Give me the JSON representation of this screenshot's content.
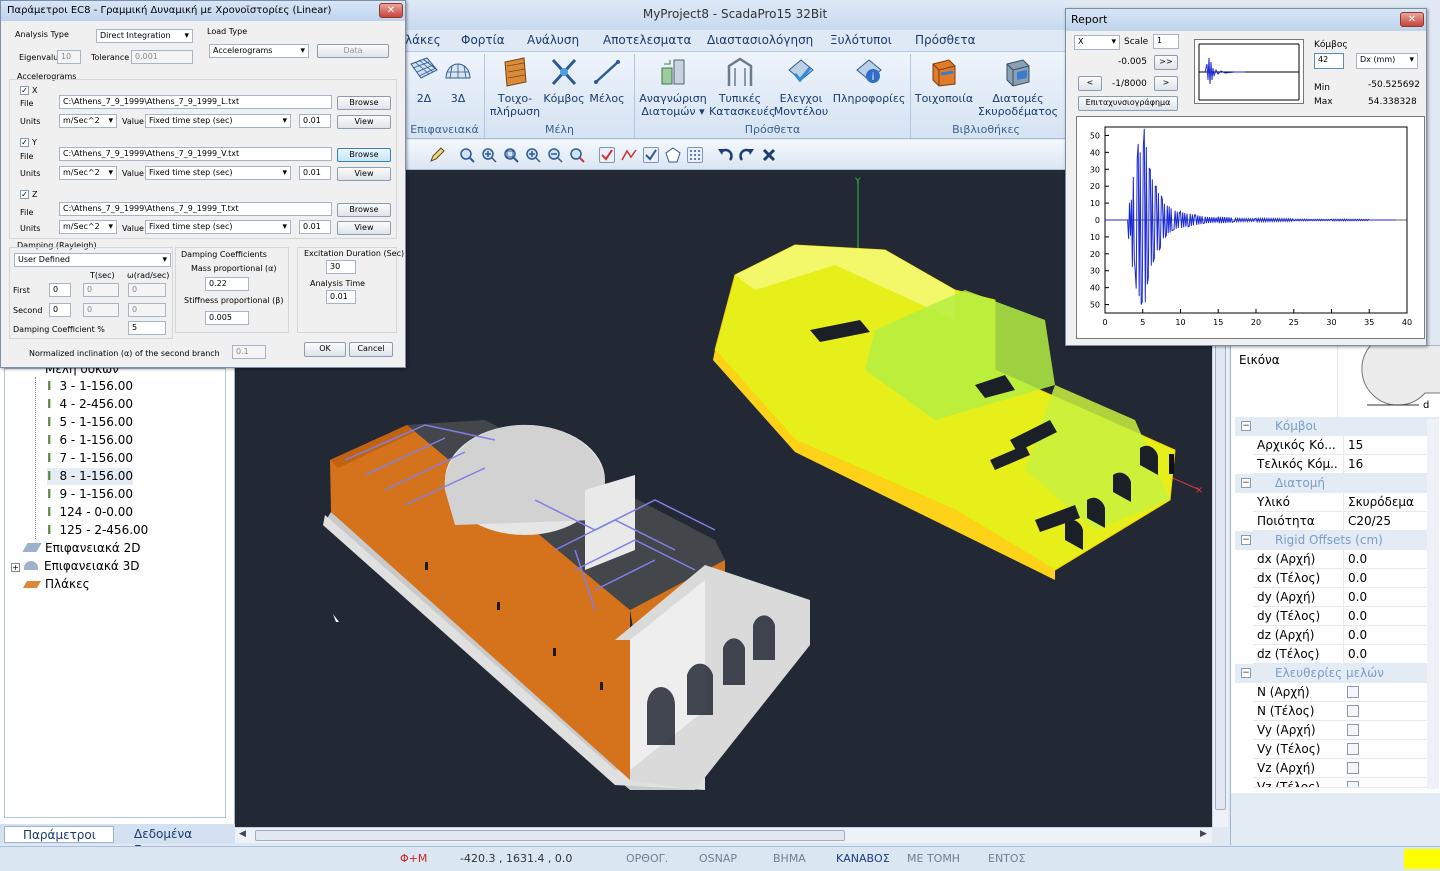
{
  "app": {
    "title": "MyProject8 - ScadaPro15 32Bit"
  },
  "menu": [
    "λάκες",
    "Φορτία",
    "Ανάλυση",
    "Αποτελεσματα",
    "Διαστασιολόγηση",
    "Ξυλότυποι",
    "Πρόσθετα"
  ],
  "ribbon": {
    "groups": [
      "Επιφανειακά",
      "Μέλη",
      "Πρόσθετα",
      "Βιβλιοθήκες"
    ],
    "buttons": {
      "b2d": "2Δ",
      "b3d": "3Δ",
      "wall": "Τοιχο-\nπλήρωση",
      "node": "Κόμβος",
      "member": "Μέλος",
      "recog": "Αναγνώριση\nΔιατομών ▾",
      "typical": "Τυπικές\nΚατασκευές",
      "check": "Ελεγχοι\nΜοντέλου",
      "info": "Πληροφορίες",
      "masonry": "Τοιχοποιία",
      "sections": "Διατομές\nΣκυροδέματος"
    }
  },
  "dialog": {
    "title": "Παράμετροι EC8 - Γραμμική Δυναμική με Χρονοϊστορίες (Linear)",
    "analysis_type_label": "Analysis Type",
    "analysis_type": "Direct Integration",
    "load_type_label": "Load Type",
    "load_type": "Accelerograms",
    "data_btn": "Data",
    "eigenvalue_label": "Eigenvalu",
    "eigenvalue": "10",
    "tolerance_label": "Tolerance",
    "tolerance": "0.001",
    "accelerograms_label": "Accelerograms",
    "file_label": "File",
    "units_label": "Units",
    "value_label": "Value",
    "browse": "Browse",
    "view": "View",
    "axes": [
      {
        "name": "X",
        "file": "C:\\Athens_7_9_1999\\Athens_7_9_1999_L.txt",
        "units": "m/Sec^2",
        "value": "Fixed time step (sec)",
        "step": "0.01"
      },
      {
        "name": "Y",
        "file": "C:\\Athens_7_9_1999\\Athens_7_9_1999_V.txt",
        "units": "m/Sec^2",
        "value": "Fixed time step (sec)",
        "step": "0.01"
      },
      {
        "name": "Z",
        "file": "C:\\Athens_7_9_1999\\Athens_7_9_1999_T.txt",
        "units": "m/Sec^2",
        "value": "Fixed time step (sec)",
        "step": "0.01"
      }
    ],
    "damping_label": "Damping (Rayleigh)",
    "damping_type": "User Defined",
    "t_sec": "T(sec)",
    "w_rad": "ω(rad/sec)",
    "first_label": "First",
    "first_val": "0",
    "first_t": "0",
    "first_w": "0",
    "second_label": "Second",
    "second_val": "0",
    "second_t": "0",
    "second_w": "0",
    "damping_coef_label": "Damping Coefficient %",
    "damping_coef": "5",
    "coefficients_label": "Damping Coefficients",
    "mass_label": "Mass proportional (α)",
    "mass": "0.22",
    "stiff_label": "Stiffness proportional (β)",
    "stiff": "0.005",
    "excitation_label": "Excitation Duration (Sec)",
    "excitation": "30",
    "analysis_time_label": "Analysis Time",
    "analysis_time": "0.01",
    "normalized_label": "Normalized inclination (α) of the second branch",
    "normalized": "0.1",
    "ok": "OK",
    "cancel": "Cancel"
  },
  "tree": {
    "header": "Μέλη δοκών",
    "members": [
      "3 - 1-156.00",
      "4 - 2-456.00",
      "5 - 1-156.00",
      "6 - 1-156.00",
      "7 - 1-156.00",
      "8 - 1-156.00",
      "9 - 1-156.00",
      "124 - 0-0.00",
      "125 - 2-456.00"
    ],
    "groups": [
      "Επιφανειακά 2D",
      "Επιφανειακά 3D",
      "Πλάκες"
    ]
  },
  "bottom_tabs": [
    "Παράμετροι Ερ...",
    "Δεδομένα Εργου"
  ],
  "report": {
    "title": "Report",
    "axis": "X",
    "scale_label": "Scale",
    "scale": "1",
    "val1": "-0.005",
    "val2": "-1/8000",
    "next": ">>",
    "prev": "<",
    "fwd": ">",
    "accel_btn": "Επιταχυνσιογράφημα",
    "node_label": "Κόμβος",
    "node": "42",
    "dx": "Dx (mm)",
    "min_label": "Min",
    "min": "-50.525692",
    "max_label": "Max",
    "max": "54.338328"
  },
  "chart_data": {
    "type": "line",
    "title": "",
    "xlabel": "",
    "ylabel": "",
    "xlim": [
      0,
      40
    ],
    "ylim": [
      -55,
      55
    ],
    "x_ticks": [
      "0",
      "5",
      "10",
      "15",
      "20",
      "25",
      "30",
      "35",
      "40"
    ],
    "y_ticks": [
      "50",
      "40",
      "30",
      "20",
      "10",
      "0",
      "10",
      "20",
      "30",
      "40",
      "50"
    ],
    "series": [
      {
        "x": [
          0,
          3.0,
          3.5,
          4.0,
          4.4,
          4.8,
          5.2,
          5.6,
          6.0,
          6.4,
          6.8,
          7.2,
          7.6,
          8.0,
          8.5,
          9.0,
          10,
          11,
          12,
          13,
          15,
          17,
          20,
          25,
          30,
          35,
          38.5
        ],
        "y": [
          0,
          0,
          12,
          -30,
          45,
          -50,
          54,
          -38,
          30,
          -25,
          20,
          -18,
          12,
          -10,
          8,
          -6,
          5,
          -4,
          3,
          -2,
          2,
          -1,
          1,
          -0.5,
          0.5,
          0,
          0
        ]
      }
    ],
    "color": "#1d2bd6"
  },
  "props": {
    "image_label": "Εικόνα",
    "sections": [
      "Κόμβοι",
      "Διατομή",
      "Rigid Offsets (cm)",
      "Ελευθερίες μελών"
    ],
    "nodes": [
      {
        "k": "Αρχικός Κό...",
        "v": "15"
      },
      {
        "k": "Τελικός Κόμ...",
        "v": "16"
      }
    ],
    "section": [
      {
        "k": "Υλικό",
        "v": "Σκυρόδεμα"
      },
      {
        "k": "Ποιότητα",
        "v": "C20/25"
      }
    ],
    "offsets": [
      {
        "k": "dx (Αρχή)",
        "v": "0.0"
      },
      {
        "k": "dx (Τέλος)",
        "v": "0.0"
      },
      {
        "k": "dy (Αρχή)",
        "v": "0.0"
      },
      {
        "k": "dy (Τέλος)",
        "v": "0.0"
      },
      {
        "k": "dz (Αρχή)",
        "v": "0.0"
      },
      {
        "k": "dz (Τέλος)",
        "v": "0.0"
      }
    ],
    "releases": [
      "N (Αρχή)",
      "N (Τέλος)",
      "Vy (Αρχή)",
      "Vy (Τέλος)",
      "Vz (Αρχή)",
      "Vz (Τέλος)"
    ]
  },
  "status": {
    "phi": "Φ+Μ",
    "coords": "-420.3 , 1631.4 , 0.0",
    "ortho": "ΟΡΘΟΓ.",
    "osnap": "OSNAP",
    "step": "ΒΗΜΑ",
    "grid": "ΚΑΝΑΒΟΣ",
    "section": "ΜΕ ΤΟΜΗ",
    "inside": "ΕΝΤΟΣ"
  }
}
